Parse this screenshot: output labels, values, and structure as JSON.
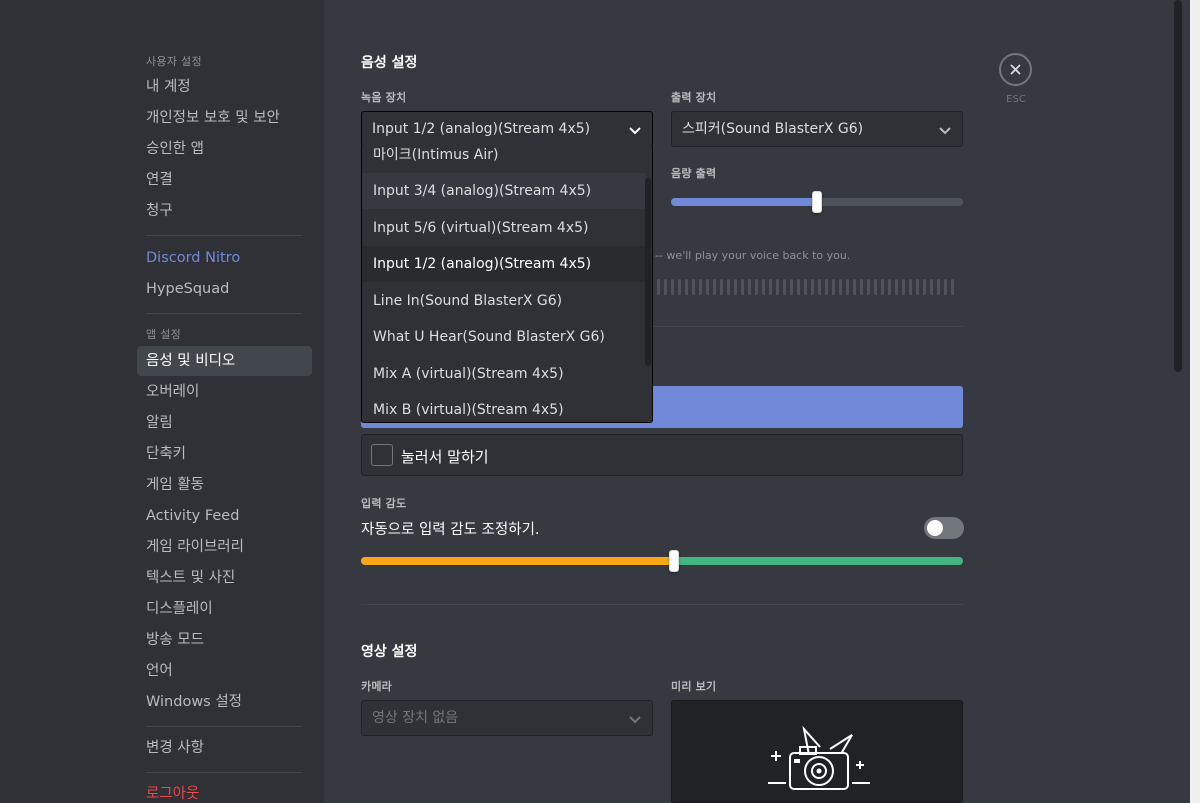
{
  "sidebar": {
    "user_settings_header": "사용자 설정",
    "user_items": [
      "내 계정",
      "개인정보 보호 및 보안",
      "승인한 앱",
      "연결",
      "청구"
    ],
    "nitro": "Discord Nitro",
    "hypesquad": "HypeSquad",
    "app_settings_header": "앱 설정",
    "app_items": [
      "음성 및 비디오",
      "오버레이",
      "알림",
      "단축키",
      "게임 활동",
      "Activity Feed",
      "게임 라이브러리",
      "텍스트 및 사진",
      "디스플레이",
      "방송 모드",
      "언어",
      "Windows 설정"
    ],
    "selected_item": "음성 및 비디오",
    "changelog": "변경 사항",
    "logout": "로그아웃"
  },
  "voice": {
    "title": "음성 설정",
    "input_label": "녹음 장치",
    "input_value": "Input 1/2 (analog)(Stream 4x5)",
    "output_label": "출력 장치",
    "output_value": "스피커(Sound BlasterX G6)",
    "output_volume_label": "음량 출력",
    "output_volume": 0.5,
    "mic_test_hint": "-- we'll play your voice back to you.",
    "push_to_talk_label": "눌러서 말하기",
    "sensitivity_label": "입력 감도",
    "auto_sensitivity_label": "자동으로 입력 감도 조정하기.",
    "auto_sensitivity_on": false,
    "sensitivity_level": 0.52
  },
  "dropdown": {
    "items": [
      "마이크(Intimus Air)",
      "Input 3/4 (analog)(Stream 4x5)",
      "Input 5/6 (virtual)(Stream 4x5)",
      "Input 1/2 (analog)(Stream 4x5)",
      "Line In(Sound BlasterX G6)",
      "What U Hear(Sound BlasterX G6)",
      "Mix A (virtual)(Stream 4x5)",
      "Mix B (virtual)(Stream 4x5)"
    ],
    "selected": "Input 1/2 (analog)(Stream 4x5)"
  },
  "video": {
    "title": "영상 설정",
    "camera_label": "카메라",
    "camera_value": "영상 장치 없음",
    "preview_label": "미리 보기"
  },
  "close": {
    "esc_label": "ESC"
  },
  "colors": {
    "sidebar_bg": "#2f3136",
    "main_bg": "#36393f",
    "accent": "#7289da",
    "sensitivity_low": "#faa61a",
    "sensitivity_high": "#43b581",
    "logout": "#f04747"
  }
}
